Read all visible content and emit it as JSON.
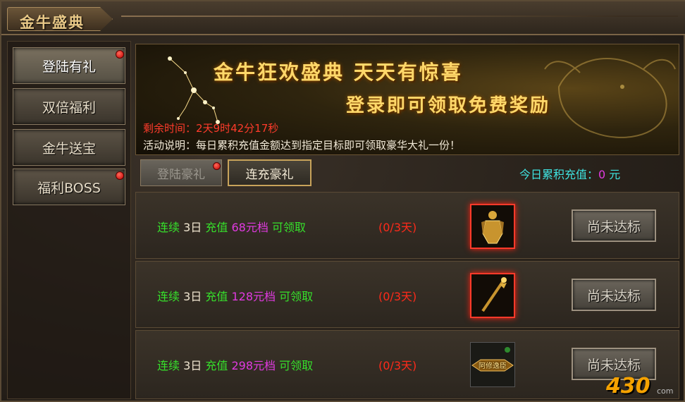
{
  "window": {
    "title": "金牛盛典"
  },
  "sidebar": {
    "items": [
      {
        "label": "登陆有礼",
        "active": true,
        "badge": true
      },
      {
        "label": "双倍福利",
        "active": false,
        "badge": false
      },
      {
        "label": "金牛送宝",
        "active": false,
        "badge": false
      },
      {
        "label": "福利BOSS",
        "active": false,
        "badge": true
      }
    ]
  },
  "banner": {
    "title_line1": "金牛狂欢盛典  天天有惊喜",
    "title_line2": "登录即可领取免费奖励",
    "time_left": "剩余时间：2天9时42分17秒",
    "description": "活动说明：每日累积充值金额达到指定目标即可领取豪华大礼一份！"
  },
  "tabs": [
    {
      "label": "登陆豪礼",
      "active": false,
      "badge": true
    },
    {
      "label": "连充豪礼",
      "active": true,
      "badge": false
    }
  ],
  "today_recharge": {
    "label": "今日累积充值：",
    "value": "0",
    "unit": " 元"
  },
  "rows": [
    {
      "p1": "连续 ",
      "days": "3日",
      "p2": " 充值 ",
      "tier": "68元档",
      "p3": " 可领取",
      "progress": "(0/3天)",
      "item": "armor-icon",
      "button": "尚未达标"
    },
    {
      "p1": "连续 ",
      "days": "3日",
      "p2": " 充值 ",
      "tier": "128元档",
      "p3": " 可领取",
      "progress": "(0/3天)",
      "item": "staff-icon",
      "button": "尚未达标"
    },
    {
      "p1": "连续 ",
      "days": "3日",
      "p2": " 充值 ",
      "tier": "298元档",
      "p3": " 可领取",
      "progress": "(0/3天)",
      "item": "title-badge-icon",
      "button": "尚未达标"
    }
  ],
  "item3_title": "阿修逸臣",
  "watermark": {
    "logo": "430",
    "sub": "com"
  }
}
